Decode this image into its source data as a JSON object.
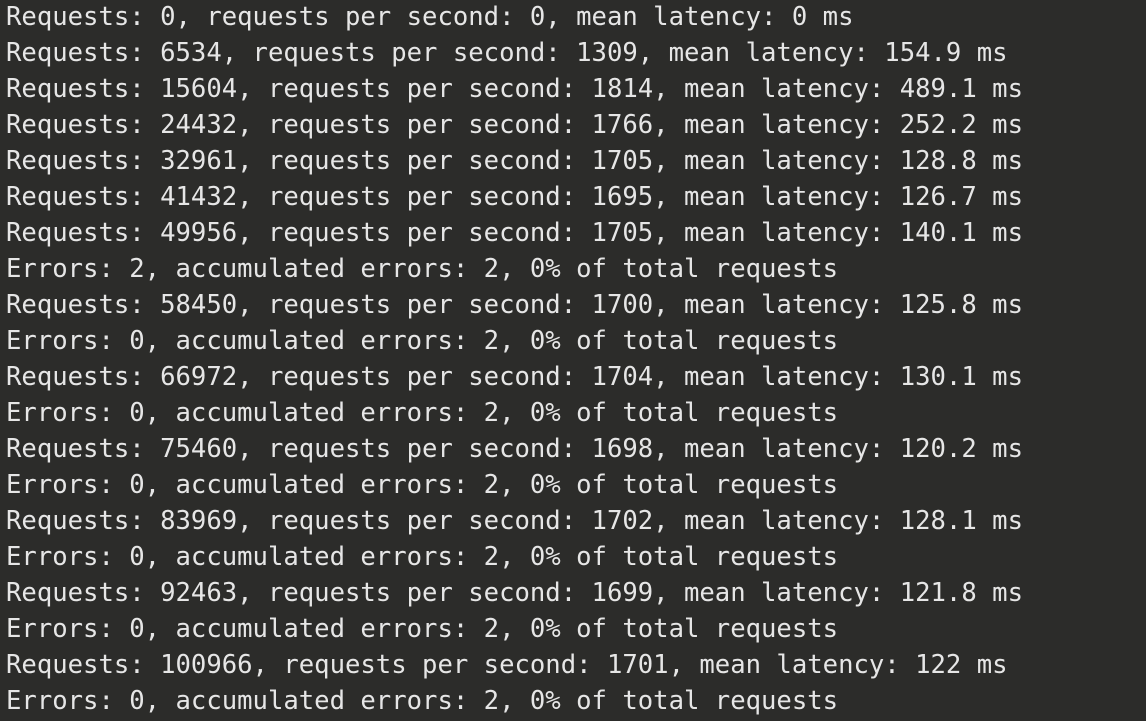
{
  "terminal": {
    "lines": [
      "Requests: 0, requests per second: 0, mean latency: 0 ms",
      "Requests: 6534, requests per second: 1309, mean latency: 154.9 ms",
      "Requests: 15604, requests per second: 1814, mean latency: 489.1 ms",
      "Requests: 24432, requests per second: 1766, mean latency: 252.2 ms",
      "Requests: 32961, requests per second: 1705, mean latency: 128.8 ms",
      "Requests: 41432, requests per second: 1695, mean latency: 126.7 ms",
      "Requests: 49956, requests per second: 1705, mean latency: 140.1 ms",
      "Errors: 2, accumulated errors: 2, 0% of total requests",
      "Requests: 58450, requests per second: 1700, mean latency: 125.8 ms",
      "Errors: 0, accumulated errors: 2, 0% of total requests",
      "Requests: 66972, requests per second: 1704, mean latency: 130.1 ms",
      "Errors: 0, accumulated errors: 2, 0% of total requests",
      "Requests: 75460, requests per second: 1698, mean latency: 120.2 ms",
      "Errors: 0, accumulated errors: 2, 0% of total requests",
      "Requests: 83969, requests per second: 1702, mean latency: 128.1 ms",
      "Errors: 0, accumulated errors: 2, 0% of total requests",
      "Requests: 92463, requests per second: 1699, mean latency: 121.8 ms",
      "Errors: 0, accumulated errors: 2, 0% of total requests",
      "Requests: 100966, requests per second: 1701, mean latency: 122 ms",
      "Errors: 0, accumulated errors: 2, 0% of total requests"
    ]
  },
  "colors": {
    "background": "#2c2c2a",
    "text": "#e6e6e6"
  }
}
